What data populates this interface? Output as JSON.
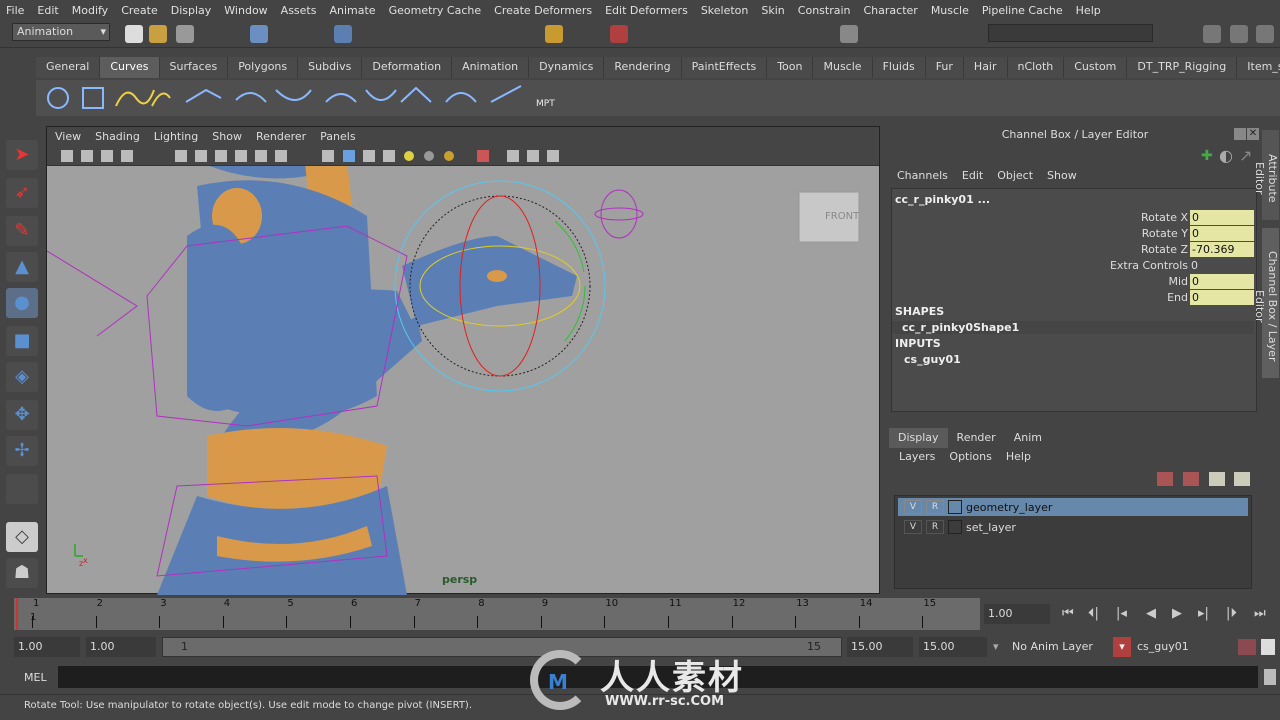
{
  "menu": [
    "File",
    "Edit",
    "Modify",
    "Create",
    "Display",
    "Window",
    "Assets",
    "Animate",
    "Geometry Cache",
    "Create Deformers",
    "Edit Deformers",
    "Skeleton",
    "Skin",
    "Constrain",
    "Character",
    "Muscle",
    "Pipeline Cache",
    "Help"
  ],
  "mode_selector": "Animation",
  "shelf_tabs": [
    "General",
    "Curves",
    "Surfaces",
    "Polygons",
    "Subdivs",
    "Deformation",
    "Animation",
    "Dynamics",
    "Rendering",
    "PaintEffects",
    "Toon",
    "Muscle",
    "Fluids",
    "Fur",
    "Hair",
    "nCloth",
    "Custom",
    "DT_TRP_Rigging",
    "Item_s"
  ],
  "active_shelf": "Curves",
  "shelf_mpt_label": "MPT",
  "viewport": {
    "menu": [
      "View",
      "Shading",
      "Lighting",
      "Show",
      "Renderer",
      "Panels"
    ],
    "camera_label": "persp",
    "view_cube": "FRONT"
  },
  "channel_box": {
    "title": "Channel Box / Layer Editor",
    "menu": [
      "Channels",
      "Edit",
      "Object",
      "Show"
    ],
    "object": "cc_r_pinky01 ...",
    "channels": [
      {
        "name": "Rotate X",
        "value": "0"
      },
      {
        "name": "Rotate Y",
        "value": "0"
      },
      {
        "name": "Rotate Z",
        "value": "-70.369"
      },
      {
        "name": "Extra Controls",
        "value": "0"
      },
      {
        "name": "Mid",
        "value": "0"
      },
      {
        "name": "End",
        "value": "0"
      }
    ],
    "shapes_header": "SHAPES",
    "shape": "cc_r_pinky0Shape1",
    "inputs_header": "INPUTS",
    "input": "cs_guy01"
  },
  "side_tabs": [
    "Attribute Editor",
    "Channel Box / Layer Editor"
  ],
  "layer_editor": {
    "tabs": [
      "Display",
      "Render",
      "Anim"
    ],
    "active_tab": "Display",
    "menu": [
      "Layers",
      "Options",
      "Help"
    ],
    "layers": [
      {
        "v": "V",
        "r": "R",
        "name": "geometry_layer",
        "selected": true
      },
      {
        "v": "V",
        "r": "R",
        "name": "set_layer",
        "selected": false
      }
    ]
  },
  "timeline": {
    "ticks": [
      "1",
      "2",
      "3",
      "4",
      "5",
      "6",
      "7",
      "8",
      "9",
      "10",
      "11",
      "12",
      "13",
      "14",
      "15"
    ],
    "current_frame_label": "1",
    "current_time": "1.00"
  },
  "range": {
    "start": "1.00",
    "playback_start": "1.00",
    "slider_start": "1",
    "slider_end": "15",
    "playback_end": "15.00",
    "end": "15.00",
    "anim_layer": "No Anim Layer",
    "character": "cs_guy01"
  },
  "command_line": {
    "label": "MEL",
    "value": ""
  },
  "help_line": "Rotate Tool: Use manipulator to rotate object(s). Use edit mode to change pivot (INSERT).",
  "watermark": "人人素材 www.rr-sc.com",
  "colors": {
    "accent_selected": "#6688aa",
    "channel_field": "#e6e6a4",
    "character_blue": "#5b7fb5",
    "character_orange": "#d89a4a",
    "rig_magenta": "#b030c0"
  }
}
